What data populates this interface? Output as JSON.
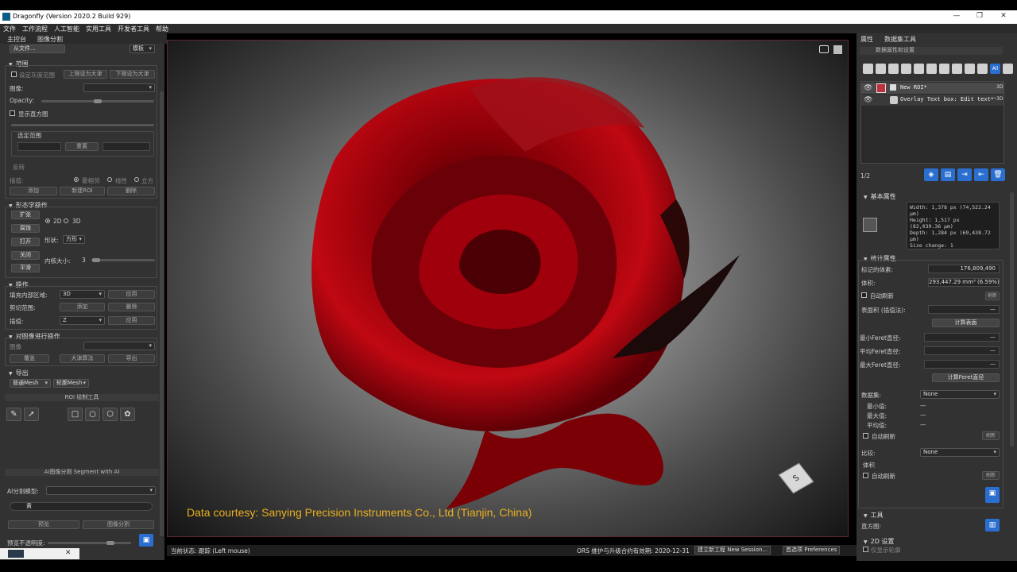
{
  "window": {
    "title": "Dragonfly (Version 2020.2 Build 929)",
    "controls": [
      "—",
      "❐",
      "✕"
    ]
  },
  "menu": [
    "文件",
    "工作流程",
    "人工智能",
    "实用工具",
    "开发者工具",
    "帮助"
  ],
  "main_tabs": [
    "主控台",
    "图像分割"
  ],
  "left": {
    "from_file": "从文件...",
    "template": "模板",
    "range": {
      "title": "范围",
      "set_range": "设定灰度范围",
      "upper_otsu": "上限设为大津",
      "lower_otsu": "下限设为大津",
      "image_label": "图像:",
      "opacity_label": "Opacity:",
      "show_hist": "显示直方图",
      "selected_range": "选定范围",
      "reset": "重置",
      "invert": "反转",
      "interp_label": "插值:",
      "interp_opts": [
        "最相邻",
        "线性",
        "立方"
      ],
      "add": "添加",
      "new_roi": "新建ROI",
      "delete": "删除"
    },
    "morph": {
      "title": "形态学操作",
      "dilate": "扩张",
      "erode": "腐蚀",
      "open": "打开",
      "close": "关闭",
      "smooth": "平滑",
      "mode_2d": "2D",
      "mode_3d": "3D",
      "shape_label": "形状:",
      "shape_value": "方形",
      "kernel_label": "内核大小:",
      "kernel_value": "3"
    },
    "ops": {
      "title": "操作",
      "fill_label": "填充内部区域:",
      "fill_value": "3D",
      "apply": "应用",
      "clip_label": "剪切范围:",
      "add": "添加",
      "delete": "删除",
      "interp_label": "插值:",
      "interp_value": "Z"
    },
    "image_ops": {
      "title": "对图像进行操作",
      "image_label": "图像",
      "overwrite": "覆盖",
      "otsu": "大津算法",
      "export": "导出"
    },
    "export": {
      "title": "导出",
      "normal_mesh": "普通Mesh",
      "contour_mesh": "轮廓Mesh"
    },
    "roi_tools": "ROI 绘制工具",
    "ai_seg": "AI图像分割 Segment with AI",
    "ai_model_label": "AI分割模型:",
    "ai_slot": "黄",
    "preview": "预览",
    "segment": "图像分割",
    "preview_opacity": "预览不透明度:"
  },
  "viewport": {
    "courtesy": "Data courtesy: Sanying Precision Instruments Co., Ltd (Tianjin, China)",
    "cube_label": "S"
  },
  "status": {
    "state": "当前状态: 跟踪 (Left mouse)",
    "maintenance": "ORS 维护与升级合约有效期: 2020-12-31",
    "new_session": "建立新工程 New Session...",
    "preferences": "首选项 Preferences"
  },
  "right": {
    "tabs": [
      "属性",
      "数据集工具"
    ],
    "header": "数据属性和设置",
    "roi_items": [
      {
        "name": "New ROI*",
        "color": "#c0303a",
        "tag": "3D"
      },
      {
        "name": "Overlay Text box: Edit text**",
        "tag": "3D"
      }
    ],
    "page": "1/2",
    "basic_title": "基本属性",
    "basic_info": "Width: 1,378 px (74,522.24\nμm)\nHeight: 1,517 px\n(82,039.36 μm)\nDepth: 1,284 px (69,438.72\nμm)\nSize change: 1",
    "stats_title": "统计属性",
    "labeled_voxels_label": "标记的体素:",
    "labeled_voxels": "176,809,490",
    "volume_label": "体积:",
    "volume": "293,447.29 mm³ (6.59%)",
    "auto_refresh": "自动刷新",
    "refresh": "刷新",
    "surface_label": "表面积 (插值法):",
    "dash": "—",
    "calc_surface": "计算表面",
    "min_feret": "最小Feret直径:",
    "mean_feret": "平均Feret直径:",
    "max_feret": "最大Feret直径:",
    "calc_feret": "计算Feret直径",
    "dataset_label": "数据集:",
    "dataset_value": "None",
    "min_label": "最小值:",
    "max_label": "最大值:",
    "mean_label": "平均值:",
    "compare_label": "比较:",
    "compare_value": "None",
    "volume2_label": "体积",
    "tools_title": "工具",
    "histogram_label": "直方图:",
    "settings_2d": "2D 设置",
    "show_outline": "仅显示轮廓"
  }
}
